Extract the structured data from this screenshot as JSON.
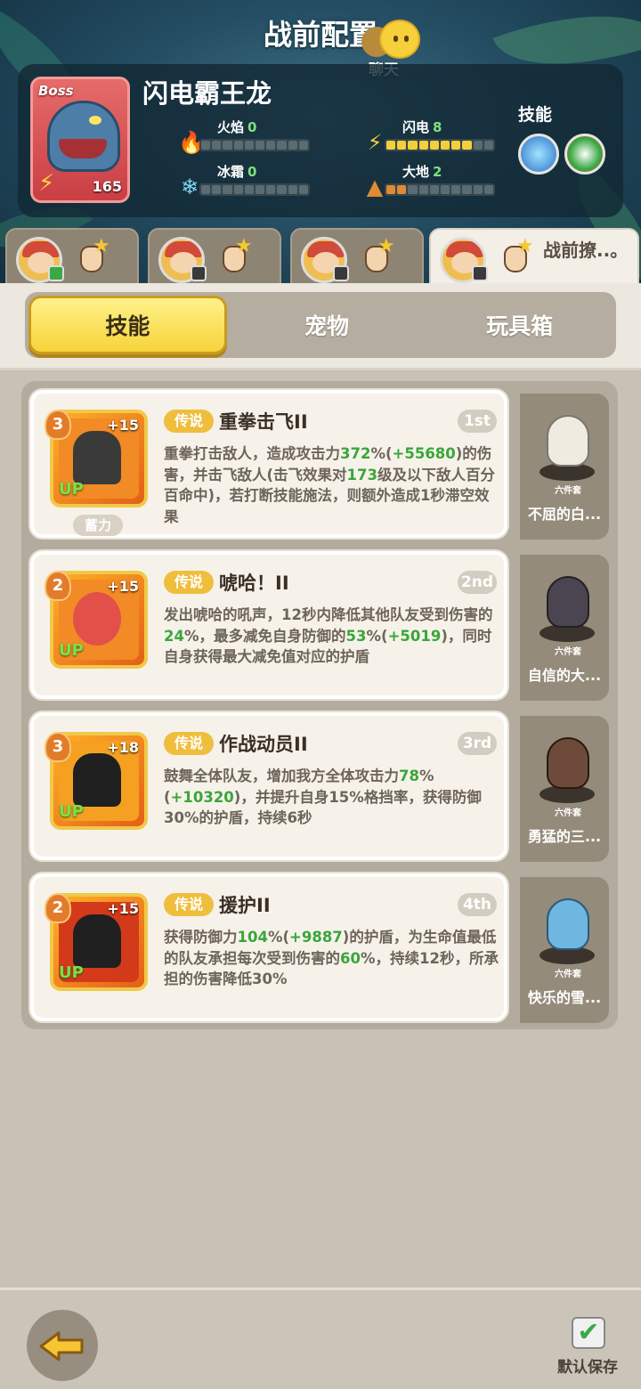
{
  "header": {
    "title": "战前配置",
    "chat_label": "聊天"
  },
  "boss": {
    "tag": "Boss",
    "name": "闪电霸王龙",
    "level": "165",
    "stats": [
      {
        "name": "火焰",
        "value": "0",
        "level": 0,
        "color": "#e0442a",
        "icon": "fire-icon"
      },
      {
        "name": "闪电",
        "value": "8",
        "level": 8,
        "color": "#f4cf3a",
        "icon": "lightning-icon"
      },
      {
        "name": "冰霜",
        "value": "0",
        "level": 0,
        "color": "#7fd3ef",
        "icon": "snowflake-icon"
      },
      {
        "name": "大地",
        "value": "2",
        "level": 2,
        "color": "#e08a33",
        "icon": "earth-icon"
      }
    ],
    "skills_label": "技能"
  },
  "hero_tabs": [
    {
      "label": "",
      "badge": "green"
    },
    {
      "label": "",
      "badge": "dark"
    },
    {
      "label": "",
      "badge": "dark"
    },
    {
      "label": "战前撩..。",
      "badge": "dark"
    }
  ],
  "tabs": [
    "技能",
    "宠物",
    "玩具箱"
  ],
  "skills": [
    {
      "rank": "3",
      "plus": "+15",
      "up": "UP",
      "extra_label": "蓄力",
      "tag": "传说",
      "name": "重拳击飞II",
      "order": "1st",
      "desc_parts": [
        "重拳打击敌人，造成攻击力",
        "372",
        "%(",
        "+55680",
        ")的伤害，并击飞敌人(击飞效果对",
        "173",
        "级及以下敌人百分百命中)，若打断技能施法，则额外造成1秒滞空效果"
      ],
      "pet": {
        "name": "不屈的白...",
        "set": "六件套",
        "color": "#f0ebe1"
      }
    },
    {
      "rank": "2",
      "plus": "+15",
      "up": "UP",
      "extra_label": "",
      "tag": "传说",
      "name": "唬哈！II",
      "order": "2nd",
      "desc_parts": [
        "发出唬哈的吼声，12秒内降低其他队友受到伤害的",
        "24",
        "%，最多减免自身防御的",
        "53",
        "%(",
        "+5019",
        ")，同时自身获得最大减免值对应的护盾"
      ],
      "pet": {
        "name": "自信的大...",
        "set": "六件套",
        "color": "#4a4550"
      }
    },
    {
      "rank": "3",
      "plus": "+18",
      "up": "UP",
      "extra_label": "",
      "tag": "传说",
      "name": "作战动员II",
      "order": "3rd",
      "desc_parts": [
        "鼓舞全体队友，增加我方全体攻击力",
        "78",
        "%(",
        "+10320",
        ")，并提升自身15%格挡率，获得防御30%的护盾，持续6秒"
      ],
      "pet": {
        "name": "勇猛的三...",
        "set": "六件套",
        "color": "#6d4a3a"
      }
    },
    {
      "rank": "2",
      "plus": "+15",
      "up": "UP",
      "extra_label": "",
      "tag": "传说",
      "name": "援护II",
      "order": "4th",
      "desc_parts": [
        "获得防御力",
        "104",
        "%(",
        "+9887",
        ")的护盾，为生命值最低的队友承担每次受到伤害的",
        "60",
        "%，持续12秒，所承担的伤害降低30%"
      ],
      "pet": {
        "name": "快乐的雪...",
        "set": "六件套",
        "color": "#6fb7e0"
      }
    }
  ],
  "footer": {
    "save_label": "默认保存"
  }
}
